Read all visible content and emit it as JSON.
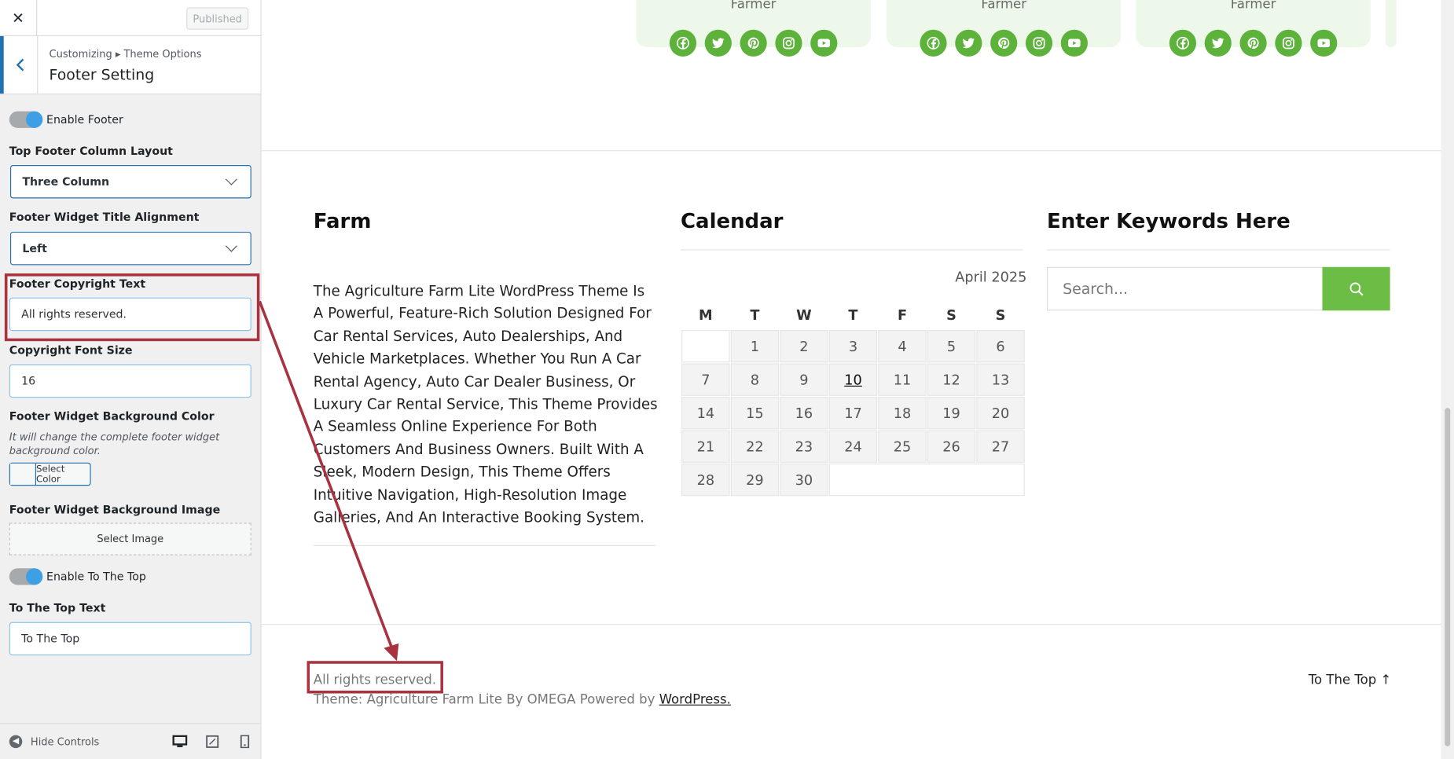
{
  "sidebar": {
    "close_label": "✕",
    "published_label": "Published",
    "breadcrumb": "Customizing ▸ Theme Options",
    "section_title": "Footer Setting",
    "enable_footer_label": "Enable Footer",
    "enable_footer_on": true,
    "column_layout_label": "Top Footer Column Layout",
    "column_layout_value": "Three Column",
    "title_alignment_label": "Footer Widget Title Alignment",
    "title_alignment_value": "Left",
    "copyright_text_label": "Footer Copyright Text",
    "copyright_text_value": "All rights reserved.",
    "copyright_font_size_label": "Copyright Font Size",
    "copyright_font_size_value": "16",
    "bg_color_label": "Footer Widget Background Color",
    "bg_color_desc": "It will change the complete footer widget background color.",
    "select_color_label": "Select Color",
    "bg_image_label": "Footer Widget Background Image",
    "select_image_label": "Select Image",
    "enable_to_top_label": "Enable To The Top",
    "enable_to_top_on": true,
    "to_top_text_label": "To The Top Text",
    "to_top_text_value": "To The Top",
    "hide_controls_label": "Hide Controls",
    "accent_color": "#2271b1"
  },
  "preview": {
    "team_cards": [
      {
        "role": "Farmer"
      },
      {
        "role": "Farmer"
      },
      {
        "role": "Farmer"
      }
    ],
    "social_icons": [
      "facebook-icon",
      "twitter-icon",
      "pinterest-icon",
      "instagram-icon",
      "youtube-icon"
    ],
    "social_color": "#5cb23a",
    "widget_farm": {
      "title": "Farm",
      "text": "The Agriculture Farm Lite WordPress Theme Is A Powerful, Feature-Rich Solution Designed For Car Rental Services, Auto Dealerships, And Vehicle Marketplaces. Whether You Run A Car Rental Agency, Auto Car Dealer Business, Or Luxury Car Rental Service, This Theme Provides A Seamless Online Experience For Both Customers And Business Owners. Built With A Sleek, Modern Design, This Theme Offers Intuitive Navigation, High-Resolution Image Galleries, And An Interactive Booking System."
    },
    "widget_calendar": {
      "title": "Calendar",
      "caption": "April 2025",
      "weekdays": [
        "M",
        "T",
        "W",
        "T",
        "F",
        "S",
        "S"
      ],
      "weeks": [
        [
          "",
          "1",
          "2",
          "3",
          "4",
          "5",
          "6"
        ],
        [
          "7",
          "8",
          "9",
          "10",
          "11",
          "12",
          "13"
        ],
        [
          "14",
          "15",
          "16",
          "17",
          "18",
          "19",
          "20"
        ],
        [
          "21",
          "22",
          "23",
          "24",
          "25",
          "26",
          "27"
        ],
        [
          "28",
          "29",
          "30",
          "",
          "",
          "",
          ""
        ]
      ],
      "today": "10"
    },
    "widget_search": {
      "title": "Enter Keywords Here",
      "placeholder": "Search...",
      "button_color": "#6cbd45"
    },
    "footer": {
      "copyright": "All rights reserved.",
      "credit_prefix": "Theme: Agriculture Farm Lite By OMEGA Powered by ",
      "credit_link": "WordPress.",
      "to_top": "To The Top ↑"
    }
  },
  "annotation_color": "#a8323e"
}
